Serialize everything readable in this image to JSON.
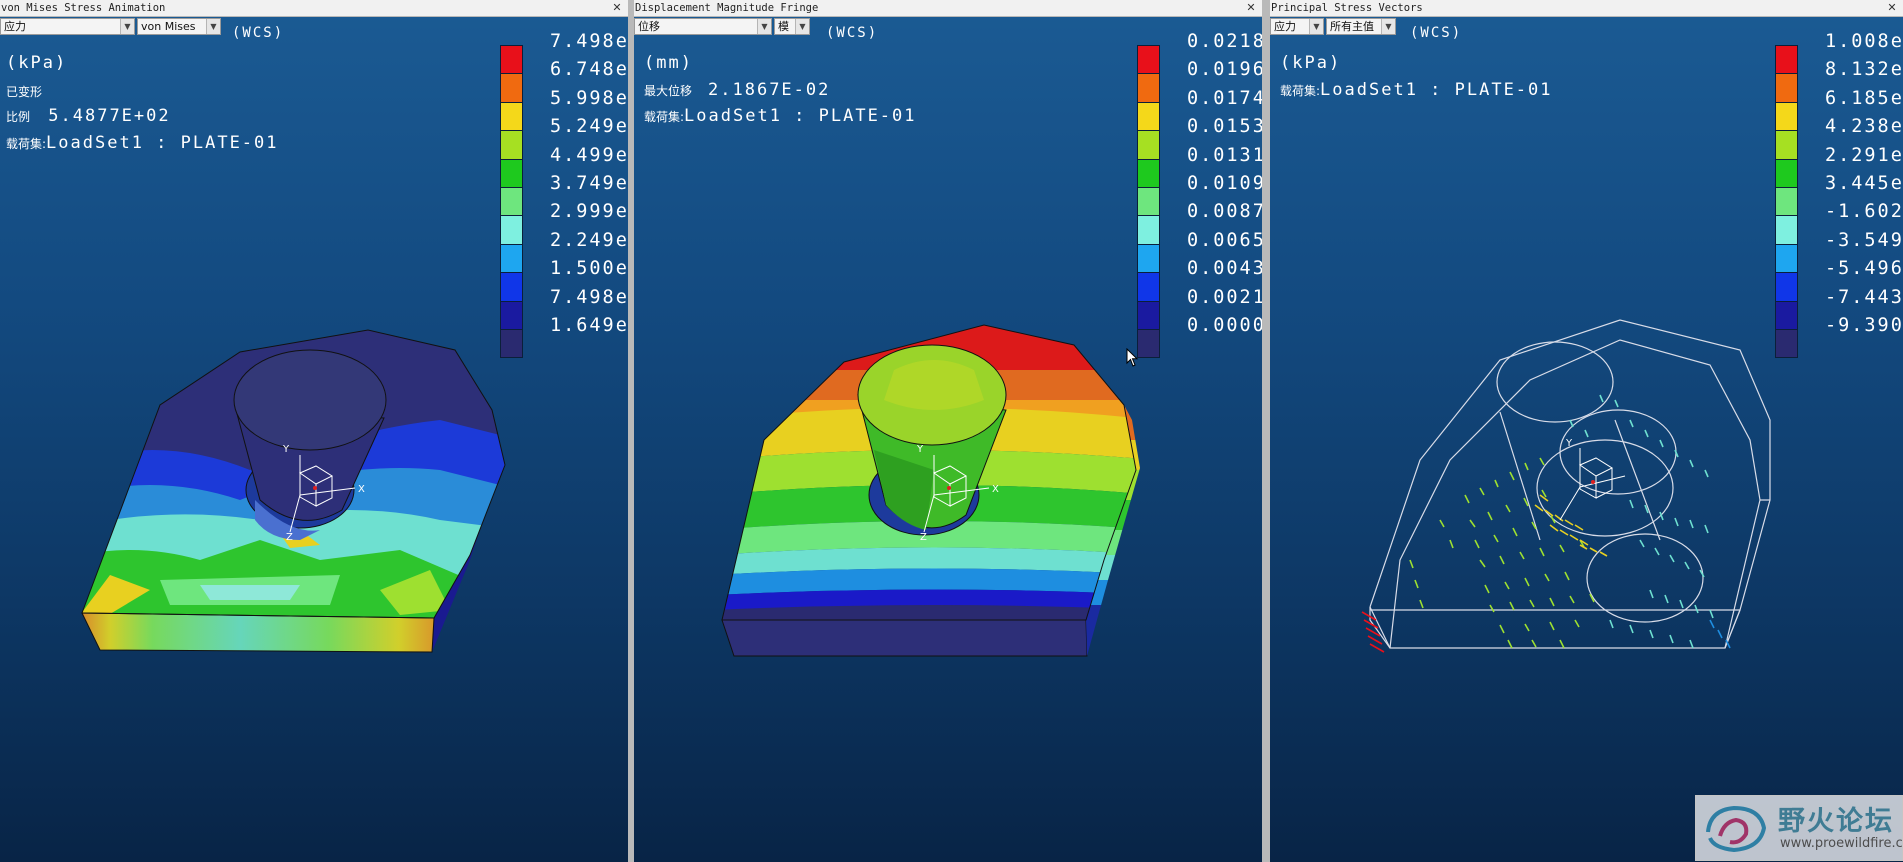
{
  "panels": [
    {
      "title": "von Mises Stress Animation",
      "combo1": "应力",
      "combo2": "von Mises",
      "wcs": "(WCS)",
      "unit": "(kPa)",
      "line_deformed": "已变形",
      "scale_label": "比例",
      "scale_value": "5.4877E+02",
      "loadset_label": "载荷集:",
      "loadset_value": "LoadSet1 :  PLATE-01",
      "legend_values": [
        "7.498e",
        "6.748e",
        "5.998e",
        "5.249e",
        "4.499e",
        "3.749e",
        "2.999e",
        "2.249e",
        "1.500e",
        "7.498e",
        "1.649e"
      ]
    },
    {
      "title": "Displacement Magnitude Fringe",
      "combo1": "位移",
      "combo2": "模",
      "wcs": "(WCS)",
      "unit": "(mm)",
      "maxdisp_label": "最大位移",
      "maxdisp_value": "2.1867E-02",
      "loadset_label": "载荷集:",
      "loadset_value": "LoadSet1 :  PLATE-01",
      "legend_values": [
        "0.0218",
        "0.0196",
        "0.0174",
        "0.0153",
        "0.0131",
        "0.0109",
        "0.0087",
        "0.0065",
        "0.0043",
        "0.0021",
        "0.0000"
      ]
    },
    {
      "title": "Principal Stress Vectors",
      "combo1": "应力",
      "combo2": "所有主值",
      "wcs": "(WCS)",
      "unit": "(kPa)",
      "loadset_label": "载荷集:",
      "loadset_value": "LoadSet1 :  PLATE-01",
      "legend_values": [
        "1.008e",
        "8.132e",
        "6.185e",
        "4.238e",
        "2.291e",
        "3.445e",
        "-1.602e",
        "-3.549e",
        "-5.496e",
        "-7.443e",
        "-9.390e"
      ]
    }
  ],
  "legend_colors": [
    "#e8101a",
    "#f06a10",
    "#f4d81a",
    "#a6e022",
    "#1ec91e",
    "#6ee67e",
    "#7ef0e0",
    "#1ea6f0",
    "#1036e8",
    "#1a1aa0",
    "#2a2a70"
  ],
  "icons": {
    "close": "close-icon",
    "dropdown": "chevron-down-icon",
    "axis": "wcs-axis-icon",
    "cursor": "mouse-cursor-icon",
    "watermark_logo": "proewildfire-logo-icon"
  },
  "watermark": {
    "title": "野火论坛",
    "url": "www.proewildfire.cn"
  }
}
